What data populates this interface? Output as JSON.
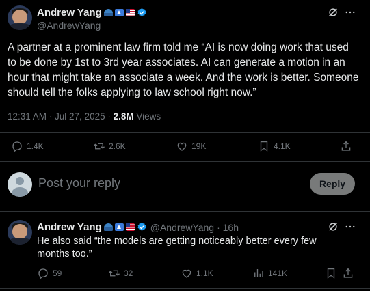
{
  "main_tweet": {
    "author_name": "Andrew Yang",
    "author_handle": "@AndrewYang",
    "badges": [
      "blue-hat-emoji",
      "up-arrow-emoji",
      "us-flag-emoji",
      "verified-badge"
    ],
    "text": "A partner at a prominent law firm told me “AI is now doing work that used to be done by 1st to 3rd year associates.  AI can generate a motion in an hour that might take an associate a week.  And the work is better.  Someone should tell the folks applying to law school right now.”",
    "timestamp": "12:31 AM · Jul 27, 2025 · ",
    "views_count": "2.8M",
    "views_label": " Views",
    "replies": "1.4K",
    "reposts": "2.6K",
    "likes": "19K",
    "bookmarks": "4.1K"
  },
  "composer": {
    "placeholder": "Post your reply",
    "reply_button": "Reply"
  },
  "reply_tweet": {
    "author_name": "Andrew Yang",
    "author_handle": "@AndrewYang",
    "age": "· 16h",
    "text": "He also said “the models are getting noticeably better every few months too.”",
    "replies": "59",
    "reposts": "32",
    "likes": "1.1K",
    "views": "141K"
  },
  "colors": {
    "background": "#000000",
    "text": "#e7e9ea",
    "muted": "#71767b",
    "divider": "#2f3336",
    "verified": "#1d9bf0",
    "reply_button_bg": "#787a7a"
  }
}
